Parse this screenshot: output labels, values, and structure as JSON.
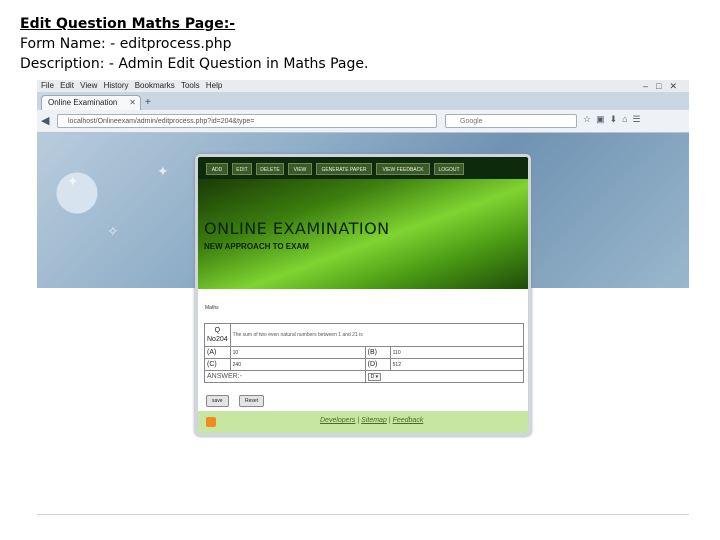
{
  "slide": {
    "title": "Edit Question Maths Page:-",
    "form_name": "Form Name: - editprocess.php",
    "description": "Description: - Admin Edit Question in Maths Page."
  },
  "browser": {
    "menu": [
      "File",
      "Edit",
      "View",
      "History",
      "Bookmarks",
      "Tools",
      "Help"
    ],
    "tab_title": "Online Examination",
    "url": "localhost/Onlineexam/admin/editprocess.php?id=204&type=",
    "search_placeholder": "Google"
  },
  "site": {
    "nav": [
      "ADD",
      "EDIT",
      "DELETE",
      "VIEW",
      "GENERATE PAPER",
      "VIEW FEEDBACK",
      "LOGOUT"
    ],
    "banner_title": "ONLINE EXAMINATION",
    "banner_subtitle": "NEW APPROACH TO EXAM",
    "page_label": "Maths",
    "question": {
      "label": "Q",
      "number": "No204",
      "text": "The sum of two even natural numbers between 1 and 21 is",
      "options": [
        {
          "label": "(A)",
          "value": "10"
        },
        {
          "label": "(B)",
          "value": "110"
        },
        {
          "label": "(C)",
          "value": "240"
        },
        {
          "label": "(D)",
          "value": "512"
        }
      ],
      "answer_label": "ANSWER:-",
      "answer_value": "D"
    },
    "buttons": {
      "save": "save",
      "reset": "Reset"
    },
    "footer": {
      "developers": "Developers",
      "sitemap": "Sitemap",
      "feedback": "Feedback",
      "sep": "|"
    }
  }
}
